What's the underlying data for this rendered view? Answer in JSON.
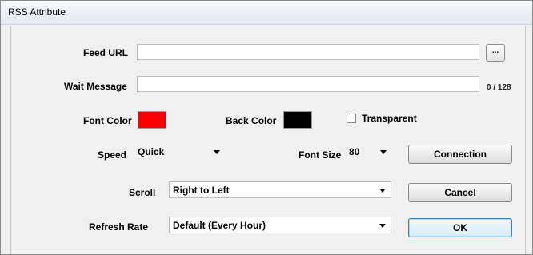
{
  "window": {
    "title": "RSS Attribute"
  },
  "feed_url": {
    "label": "Feed URL",
    "value": "",
    "browse_label": "..."
  },
  "wait_message": {
    "label": "Wait Message",
    "value": "",
    "counter": "0 / 128"
  },
  "font_color": {
    "label": "Font Color",
    "color": "#ff0000"
  },
  "back_color": {
    "label": "Back Color",
    "color": "#000000"
  },
  "transparent": {
    "label": "Transparent",
    "checked": false
  },
  "speed": {
    "label": "Speed",
    "value": "Quick"
  },
  "font_size": {
    "label": "Font Size",
    "value": "80"
  },
  "scroll": {
    "label": "Scroll",
    "value": "Right to Left"
  },
  "refresh_rate": {
    "label": "Refresh Rate",
    "value": "Default (Every Hour)"
  },
  "buttons": {
    "connection": "Connection",
    "cancel": "Cancel",
    "ok": "OK"
  }
}
